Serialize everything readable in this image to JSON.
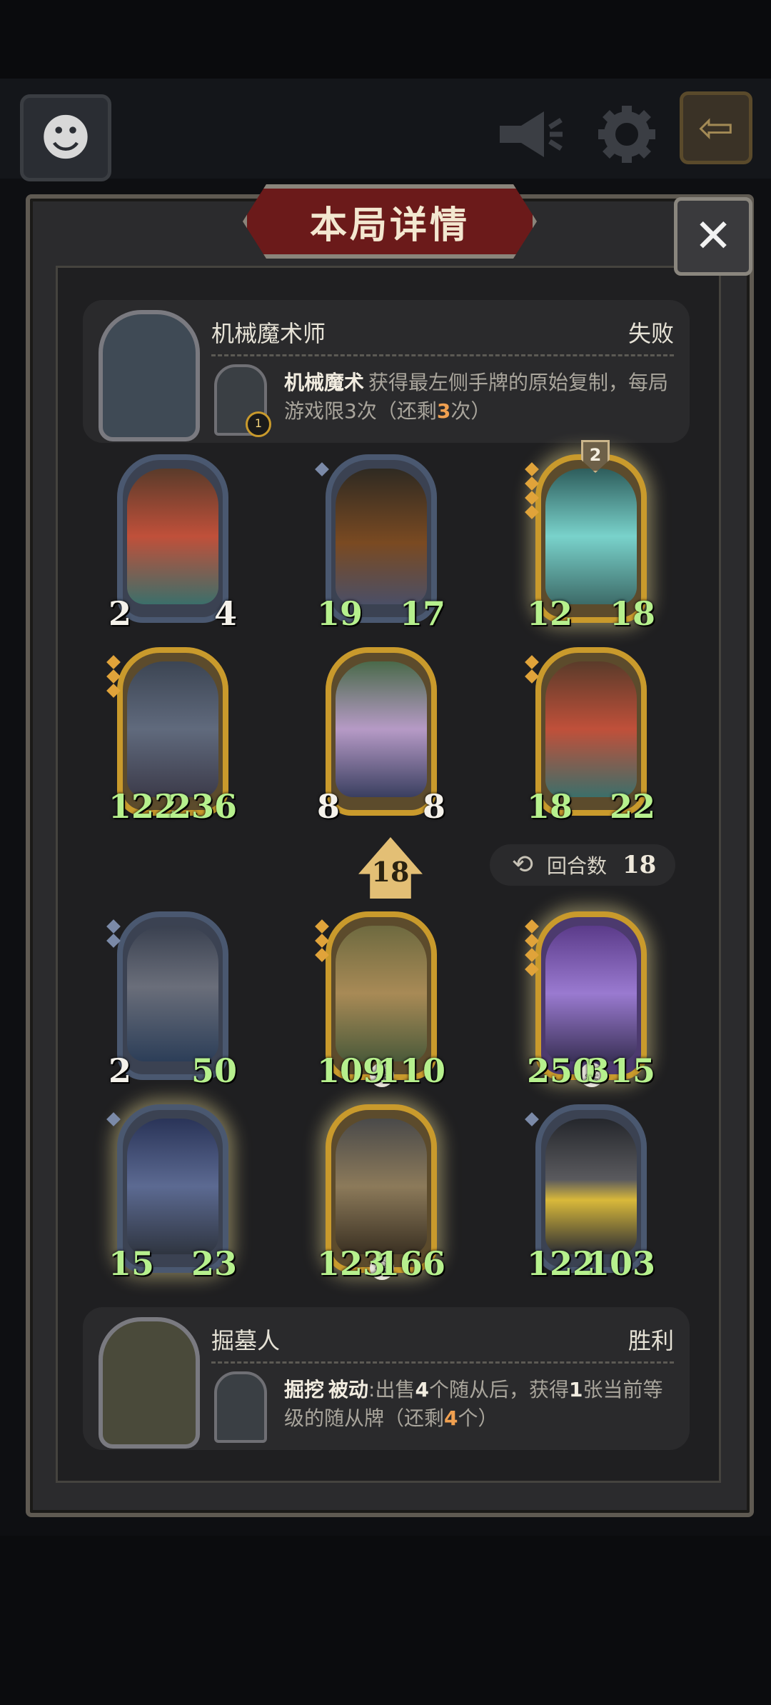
{
  "title": "本局详情",
  "close_label": "✕",
  "top_bar": {
    "avatar_glyph": "☻",
    "announce_icon": "megaphone-icon",
    "settings_icon": "gear-icon",
    "exit_icon": "exit-icon"
  },
  "opponent": {
    "name": "机械魔术师",
    "result": "失败",
    "hero_level": "1",
    "ability_name": "机械魔术",
    "ability_pre": "获得最左侧手牌的原始复制，每局游戏限",
    "limit": "3",
    "ability_mid": "次（还剩",
    "remaining": "3",
    "ability_post": "次）"
  },
  "opponent_minions": [
    {
      "attack": "2",
      "health": "4"
    },
    {
      "attack": "19",
      "health": "17"
    },
    {
      "attack": "12",
      "health": "18",
      "badge": "2"
    },
    {
      "attack": "122",
      "health": "236"
    },
    {
      "attack": "8",
      "health": "8"
    },
    {
      "attack": "18",
      "health": "22"
    }
  ],
  "tavern_tier": "18",
  "rounds": {
    "label": "回合数",
    "value": "18"
  },
  "player_minions": [
    {
      "attack": "2",
      "health": "50"
    },
    {
      "attack": "109",
      "health": "110"
    },
    {
      "attack": "250",
      "health": "315"
    },
    {
      "attack": "15",
      "health": "23"
    },
    {
      "attack": "123",
      "health": "166"
    },
    {
      "attack": "122",
      "health": "103"
    }
  ],
  "player": {
    "name": "掘墓人",
    "result": "胜利",
    "ability_name": "掘挖",
    "ability_tag": "被动",
    "ability_pre": ":出售",
    "sell_count": "4",
    "ability_mid": "个随从后，获得",
    "card_count": "1",
    "ability_mid2": "张当前等级的随从牌（还剩",
    "remaining": "4",
    "ability_post": "个）"
  },
  "colors": {
    "frame_gold": "#c99a2c",
    "frame_blue": "#4a5870",
    "buff_green": "#b6f08d",
    "highlight_orange": "#f0a050",
    "banner_red": "#6b1a1a"
  }
}
